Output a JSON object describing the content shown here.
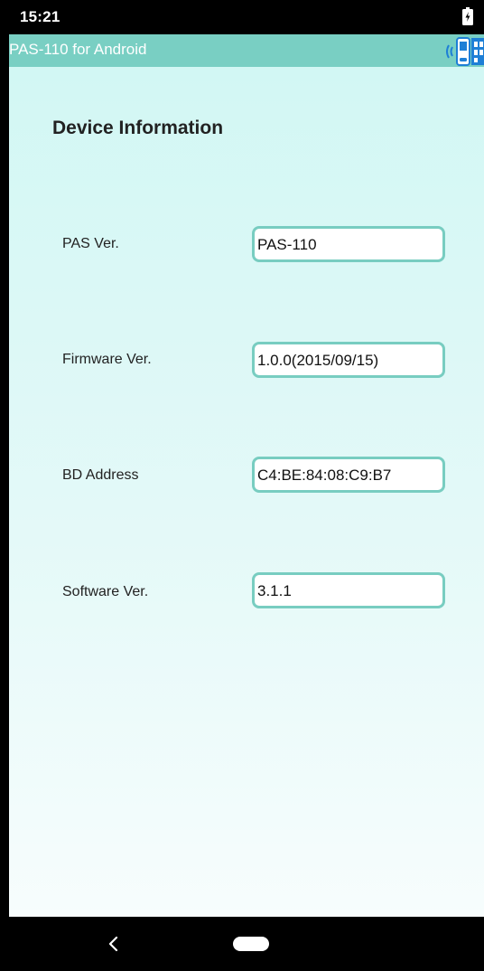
{
  "status_bar": {
    "time": "15:21",
    "battery_icon": "battery-charging-icon"
  },
  "app_bar": {
    "title": "PAS-110 for Android",
    "connection_icon": "bluetooth-device-icon",
    "background_color": "#79cfc3"
  },
  "device_info": {
    "title": "Device Information",
    "fields": [
      {
        "label": "PAS Ver.",
        "value": "PAS-110"
      },
      {
        "label": "Firmware Ver.",
        "value": "1.0.0(2015/09/15)"
      },
      {
        "label": "BD Address",
        "value": "C4:BE:84:08:C9:B7"
      },
      {
        "label": "Software Ver.",
        "value": "3.1.1"
      }
    ],
    "field_border_color": "#78cdc1"
  },
  "nav_bar": {
    "back_icon": "back-chevron-icon",
    "home_icon": "home-pill-icon"
  }
}
